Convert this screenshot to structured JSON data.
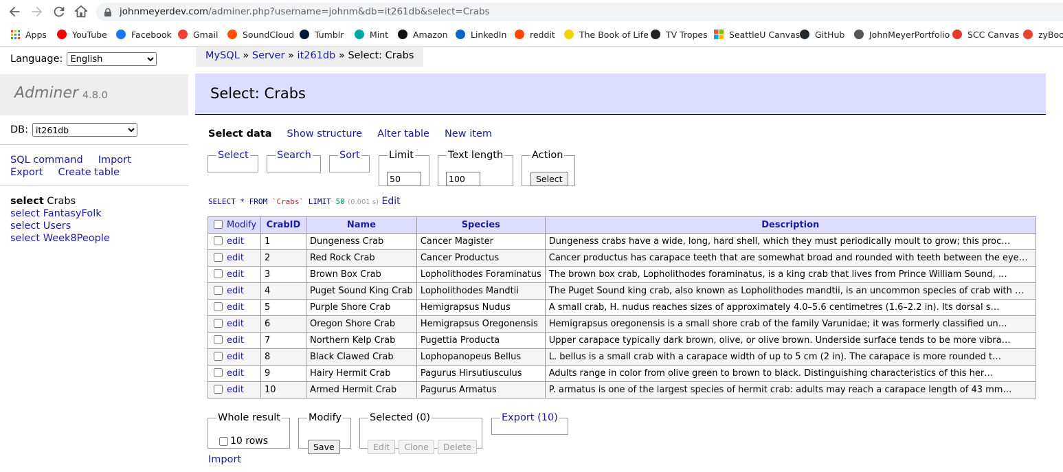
{
  "browser": {
    "url_host": "johnmeyerdev.com",
    "url_path": "/adminer.php?username=johnm&db=it261db&select=Crabs",
    "bookmarks": [
      {
        "label": "Apps",
        "icon": "apps-grid-icon",
        "color": "#4285f4"
      },
      {
        "label": "YouTube",
        "icon": "youtube-icon",
        "color": "#ff0000"
      },
      {
        "label": "Facebook",
        "icon": "facebook-icon",
        "color": "#1877f2"
      },
      {
        "label": "Gmail",
        "icon": "gmail-icon",
        "color": "#ea4335"
      },
      {
        "label": "SoundCloud",
        "icon": "soundcloud-icon",
        "color": "#ff5500"
      },
      {
        "label": "Tumblr",
        "icon": "tumblr-icon",
        "color": "#001935"
      },
      {
        "label": "Mint",
        "icon": "mint-icon",
        "color": "#00a6a4"
      },
      {
        "label": "Amazon",
        "icon": "amazon-icon",
        "color": "#111111"
      },
      {
        "label": "LinkedIn",
        "icon": "linkedin-icon",
        "color": "#0a66c2"
      },
      {
        "label": "reddit",
        "icon": "reddit-icon",
        "color": "#ff4500"
      },
      {
        "label": "The Book of Life",
        "icon": "book-of-life-icon",
        "color": "#f4d400"
      },
      {
        "label": "TV Tropes",
        "icon": "tv-tropes-icon",
        "color": "#222222"
      },
      {
        "label": "SeattleU Canvas",
        "icon": "seattleu-canvas-icon",
        "color": "#e04a2f"
      },
      {
        "label": "GitHub",
        "icon": "github-icon",
        "color": "#24292e"
      },
      {
        "label": "JohnMeyerPortfolio",
        "icon": "globe-icon",
        "color": "#555555"
      },
      {
        "label": "SCC Canvas",
        "icon": "canvas-icon",
        "color": "#e4392a"
      },
      {
        "label": "zyBooks",
        "icon": "zybooks-icon",
        "color": "#e6462f"
      }
    ]
  },
  "menu": {
    "language_label": "Language:",
    "language_value": "English",
    "logo_name": "Adminer",
    "logo_version": "4.8.0",
    "db_label": "DB:",
    "db_value": "it261db",
    "links": {
      "sql_command": "SQL command",
      "import": "Import",
      "export": "Export",
      "create_table": "Create table"
    },
    "tables": [
      {
        "prefix": "select",
        "name": "Crabs",
        "active": true
      },
      {
        "prefix": "select",
        "name": "FantasyFolk",
        "active": false
      },
      {
        "prefix": "select",
        "name": "Users",
        "active": false
      },
      {
        "prefix": "select",
        "name": "Week8People",
        "active": false
      }
    ]
  },
  "breadcrumb": {
    "mysql": "MySQL",
    "server": "Server",
    "db": "it261db",
    "sep": "»",
    "current": "Select: Crabs"
  },
  "page": {
    "title": "Select: Crabs",
    "tabs": {
      "select_data": "Select data",
      "show_structure": "Show structure",
      "alter_table": "Alter table",
      "new_item": "New item"
    },
    "fieldsets": {
      "select": "Select",
      "search": "Search",
      "sort": "Sort",
      "limit": "Limit",
      "limit_value": "50",
      "text_length": "Text length",
      "text_length_value": "100",
      "action": "Action",
      "action_button": "Select"
    },
    "sql": {
      "kw1": "SELECT",
      "star": "*",
      "kw2": "FROM",
      "table": "`Crabs`",
      "kw3": "LIMIT",
      "limit": "50",
      "time": "(0.001 s)",
      "edit": "Edit"
    }
  },
  "table": {
    "columns": [
      "Modify",
      "CrabID",
      "Name",
      "Species",
      "Description"
    ],
    "edit_label": "edit",
    "rows": [
      {
        "id": "1",
        "name": "Dungeness Crab",
        "species": "Cancer Magister",
        "description": "Dungeness crabs have a wide, long, hard shell, which they must periodically moult to grow; this proc…"
      },
      {
        "id": "2",
        "name": "Red Rock Crab",
        "species": "Cancer Productus",
        "description": "Cancer productus has carapace teeth that are somewhat broad and rounded with teeth between the eyes …"
      },
      {
        "id": "3",
        "name": "Brown Box Crab",
        "species": "Lopholithodes Foraminatus",
        "description": "The brown box crab, Lopholithodes foraminatus, is a king crab that lives from Prince William Sound, …"
      },
      {
        "id": "4",
        "name": "Puget Sound King Crab",
        "species": "Lopholithodes Mandtii",
        "description": "The Puget Sound king crab, also known as Lopholithodes mandtii, is an uncommon species of crab with …"
      },
      {
        "id": "5",
        "name": "Purple Shore Crab",
        "species": "Hemigrapsus Nudus",
        "description": "A small crab, H. nudus reaches sizes of approximately 4.0–5.6 centimetres (1.6–2.2 in). Its dorsal s…"
      },
      {
        "id": "6",
        "name": "Oregon Shore Crab",
        "species": "Hemigrapsus Oregonensis",
        "description": "Hemigrapsus oregonensis is a small shore crab of the family Varunidae; it was formerly classified un…"
      },
      {
        "id": "7",
        "name": "Northern Kelp Crab",
        "species": "Pugettia Producta",
        "description": "Upper carapace typically dark brown, olive, or olive brown. Underside surface tends to be more vibra…"
      },
      {
        "id": "8",
        "name": "Black Clawed Crab",
        "species": "Lophopanopeus Bellus",
        "description": "L. bellus is a small crab with a carapace width of up to 5 cm (2 in). The carapace is more rounded t…"
      },
      {
        "id": "9",
        "name": "Hairy Hermit Crab",
        "species": "Pagurus Hirsutiusculus",
        "description": "Adults range in color from olive green to brown to black. Distinguishing characteristics of this her…"
      },
      {
        "id": "10",
        "name": "Armed Hermit Crab",
        "species": "Pagurus Armatus",
        "description": "P. armatus is one of the largest species of hermit crab: adults may reach a carapace length of 43 mm…"
      }
    ]
  },
  "footer": {
    "whole_result": "Whole result",
    "rows_label": "10 rows",
    "modify": "Modify",
    "save": "Save",
    "selected": "Selected (0)",
    "edit": "Edit",
    "clone": "Clone",
    "delete": "Delete",
    "export": "Export (10)",
    "import": "Import"
  },
  "colors": {
    "link": "#1a1aa6",
    "header_bg": "#ddddff",
    "logo_bg": "#eeeeee"
  }
}
